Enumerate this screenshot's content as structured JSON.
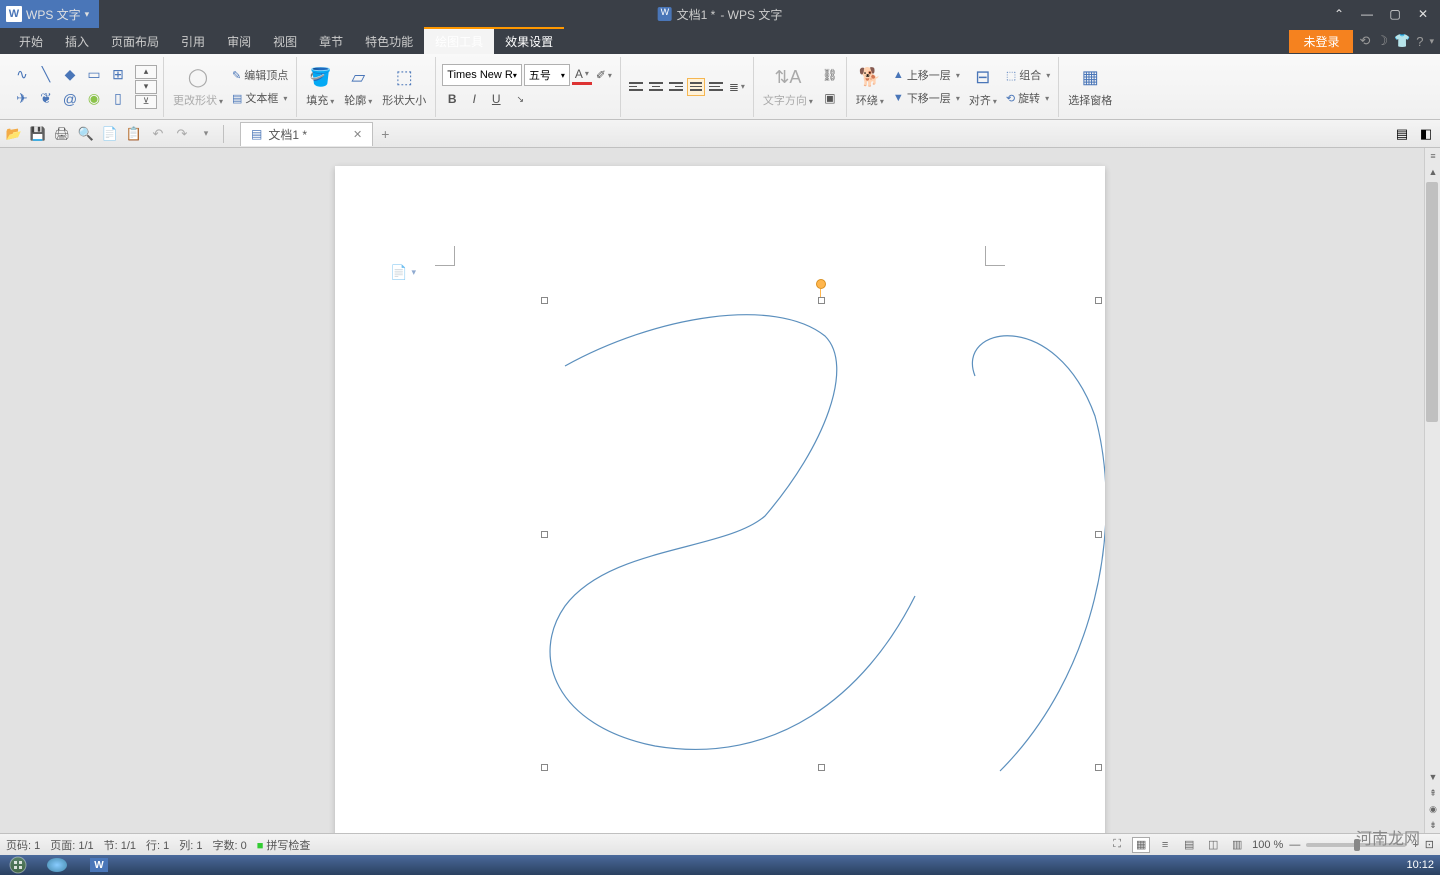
{
  "app": {
    "name": "WPS 文字",
    "title_doc": "文档1 *",
    "title_suffix": "- WPS 文字",
    "dropdown": "▾"
  },
  "menu": {
    "start": "开始",
    "insert": "插入",
    "layout": "页面布局",
    "ref": "引用",
    "review": "审阅",
    "view": "视图",
    "chapter": "章节",
    "special": "特色功能",
    "drawing": "绘图工具",
    "effect": "效果设置",
    "login": "未登录"
  },
  "ribbon": {
    "change_shape": "更改形状",
    "edit_points": "编辑顶点",
    "text_box": "文本框",
    "fill": "填充",
    "outline": "轮廓",
    "shape_size": "形状大小",
    "font_name": "Times New R",
    "font_size": "五号",
    "text_dir": "文字方向",
    "wrap": "环绕",
    "bring_fwd": "上移一层",
    "send_back": "下移一层",
    "align": "对齐",
    "group": "组合",
    "rotate": "旋转",
    "select_pane": "选择窗格"
  },
  "doc_tab": {
    "name": "文档1 *"
  },
  "status": {
    "page_num": "页码: 1",
    "page": "页面: 1/1",
    "section": "节: 1/1",
    "line": "行: 1",
    "col": "列: 1",
    "words": "字数: 0",
    "spell": "拼写检查",
    "zoom": "100 %"
  },
  "watermark": "河南龙网",
  "clock": "10:12"
}
